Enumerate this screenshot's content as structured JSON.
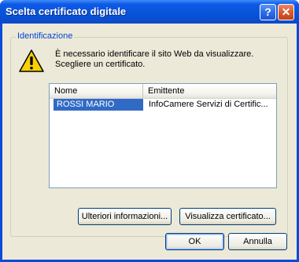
{
  "window": {
    "title": "Scelta certificato digitale",
    "help_button": "?",
    "close_button": "✕"
  },
  "group": {
    "label": "Identificazione",
    "message_line1": "È necessario identificare il sito Web da visualizzare.",
    "message_line2": "Scegliere un certificato."
  },
  "table": {
    "columns": [
      "Nome",
      "Emittente"
    ],
    "rows": [
      {
        "nome": "ROSSI MARIO",
        "emittente": "InfoCamere Servizi di Certific...",
        "selected": true
      }
    ]
  },
  "buttons": {
    "more_info": "Ulteriori informazioni...",
    "view_certificate": "Visualizza certificato...",
    "ok": "OK",
    "cancel": "Annulla"
  },
  "icons": {
    "warning": "warning-icon"
  },
  "colors": {
    "titlebar": "#0a4bd8",
    "client_bg": "#ece9d8",
    "group_label": "#0046d5",
    "selection": "#316ac5"
  }
}
